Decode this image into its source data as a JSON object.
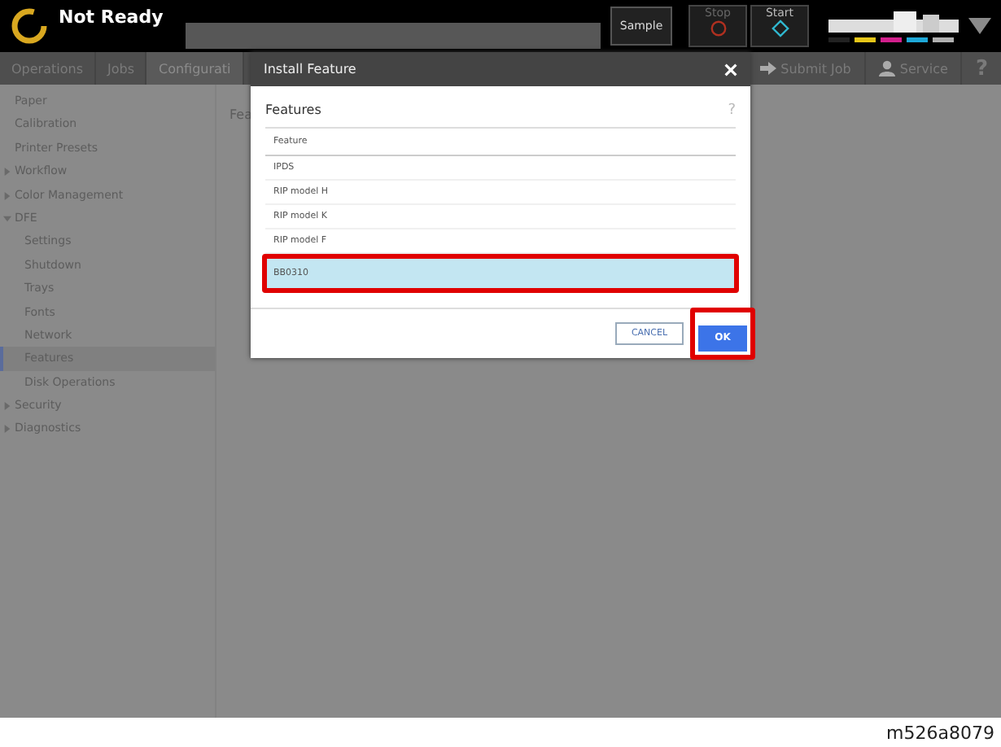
{
  "header": {
    "status": "Not Ready",
    "sample_button": "Sample",
    "stop_button": "Stop",
    "start_button": "Start",
    "toner": [
      {
        "color": "#222222"
      },
      {
        "color": "#e6c619"
      },
      {
        "color": "#d21f8c"
      },
      {
        "color": "#1ea8d8"
      },
      {
        "color": "#b0b0b0"
      }
    ]
  },
  "nav": {
    "tabs": [
      {
        "label": "Operations",
        "selected": false
      },
      {
        "label": "Jobs",
        "selected": false
      },
      {
        "label": "Configurati",
        "selected": true
      }
    ],
    "submit_job": "Submit Job",
    "service": "Service",
    "help": "?"
  },
  "sidebar": {
    "items": [
      {
        "label": "Paper",
        "selected": false
      },
      {
        "label": "Calibration",
        "selected": false
      },
      {
        "label": "Printer Presets",
        "selected": false
      },
      {
        "label": "Workflow",
        "expanded": false,
        "selected": false
      },
      {
        "label": "Color Management",
        "expanded": false,
        "selected": false
      },
      {
        "label": "DFE",
        "expanded": true,
        "selected": false,
        "children": [
          {
            "label": "Settings",
            "selected": false
          },
          {
            "label": "Shutdown",
            "selected": false
          },
          {
            "label": "Trays",
            "selected": false
          },
          {
            "label": "Fonts",
            "selected": false
          },
          {
            "label": "Network",
            "selected": false
          },
          {
            "label": "Features",
            "selected": true
          },
          {
            "label": "Disk Operations",
            "selected": false
          }
        ]
      },
      {
        "label": "Security",
        "expanded": false,
        "selected": false
      },
      {
        "label": "Diagnostics",
        "expanded": false,
        "selected": false
      }
    ]
  },
  "main": {
    "title": "Fea"
  },
  "dialog": {
    "title": "Install Feature",
    "section": "Features",
    "help": "?",
    "column": "Feature",
    "rows": [
      {
        "label": "IPDS",
        "selected": false
      },
      {
        "label": "RIP model H",
        "selected": false
      },
      {
        "label": "RIP model K",
        "selected": false
      },
      {
        "label": "RIP model F",
        "selected": false
      },
      {
        "label": "BB0310",
        "selected": true
      }
    ],
    "cancel": "CANCEL",
    "ok": "OK"
  },
  "caption": "m526a8079"
}
